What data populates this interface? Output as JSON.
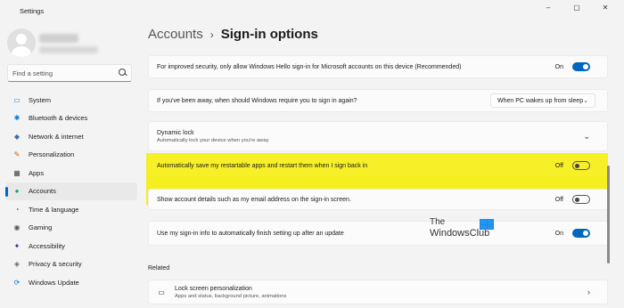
{
  "app_title": "Settings",
  "window_controls": {
    "minimize": "–",
    "maximize": "▢",
    "close": "✕"
  },
  "search": {
    "placeholder": "Find a setting"
  },
  "nav": [
    {
      "label": "System",
      "icon": "monitor-icon",
      "glyph": "▭",
      "color": "#0078d4"
    },
    {
      "label": "Bluetooth & devices",
      "icon": "bluetooth-icon",
      "glyph": "✱",
      "color": "#0078d4"
    },
    {
      "label": "Network & internet",
      "icon": "wifi-icon",
      "glyph": "◆",
      "color": "#3a6ea5"
    },
    {
      "label": "Personalization",
      "icon": "brush-icon",
      "glyph": "✎",
      "color": "#c06000"
    },
    {
      "label": "Apps",
      "icon": "apps-icon",
      "glyph": "▦",
      "color": "#444"
    },
    {
      "label": "Accounts",
      "icon": "person-icon",
      "glyph": "●",
      "color": "#1aa260",
      "active": true
    },
    {
      "label": "Time & language",
      "icon": "globe-icon",
      "glyph": "◔",
      "color": "#0078d4"
    },
    {
      "label": "Gaming",
      "icon": "gamepad-icon",
      "glyph": "◉",
      "color": "#555"
    },
    {
      "label": "Accessibility",
      "icon": "accessibility-icon",
      "glyph": "✦",
      "color": "#2b2b8f"
    },
    {
      "label": "Privacy & security",
      "icon": "shield-icon",
      "glyph": "◈",
      "color": "#666"
    },
    {
      "label": "Windows Update",
      "icon": "update-icon",
      "glyph": "⟳",
      "color": "#0078d4"
    }
  ],
  "breadcrumb": {
    "parent": "Accounts",
    "separator": "›",
    "current": "Sign-in options"
  },
  "settings": {
    "hello_only": {
      "label": "For improved security, only allow Windows Hello sign-in for Microsoft accounts on this device (Recommended)",
      "state": "On"
    },
    "away": {
      "label": "If you've been away, when should Windows require you to sign in again?",
      "value": "When PC wakes up from sleep"
    },
    "dynamic_lock": {
      "label": "Dynamic lock",
      "sub": "Automatically lock your device when you're away"
    },
    "restart_apps": {
      "label": "Automatically save my restartable apps and restart them when I sign back in",
      "state": "Off"
    },
    "account_details": {
      "label": "Show account details such as my email address on the sign-in screen.",
      "state": "Off"
    },
    "signin_info": {
      "label": "Use my sign-in info to automatically finish setting up after an update",
      "state": "On"
    }
  },
  "related": {
    "title": "Related",
    "lock_screen": {
      "label": "Lock screen personalization",
      "sub": "Apps and status, background picture, animations"
    }
  },
  "watermark": {
    "line1": "The",
    "line2": "WindowsClub"
  },
  "colors": {
    "accent": "#0067c0",
    "highlight": "#f6ef1f"
  }
}
